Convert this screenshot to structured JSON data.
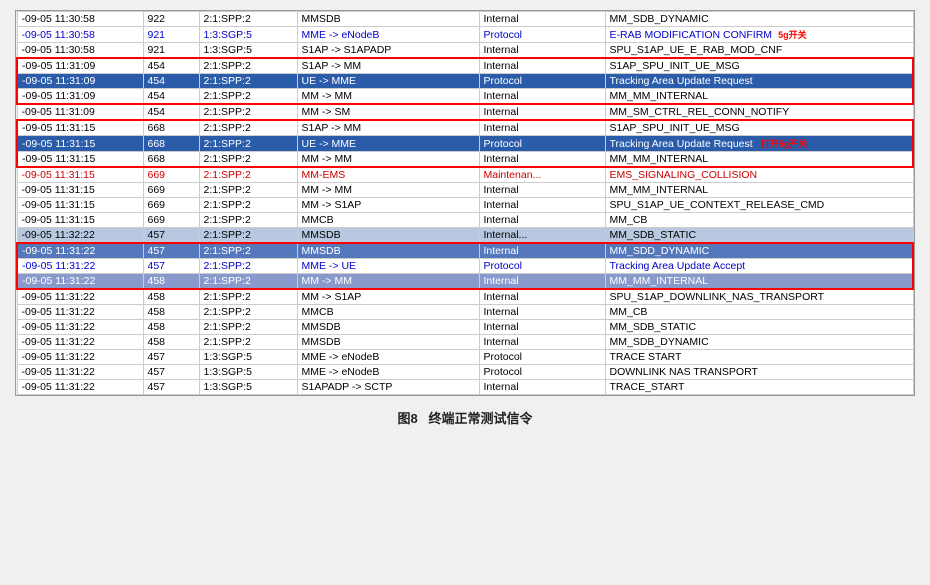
{
  "caption": {
    "figure_number": "图8",
    "title": "终端正常测试信令"
  },
  "rows": [
    {
      "ts": "-09-05 11:30:58",
      "id": "922",
      "node": "2:1:SPP:2",
      "source": "MMSDB",
      "type": "Internal",
      "msg": "MM_SDB_DYNAMIC",
      "style": "normal",
      "boxed": false
    },
    {
      "ts": "-09-05 11:30:58",
      "id": "921",
      "node": "1:3:SGP:5",
      "source": "MME -> eNodeB",
      "type": "Protocol",
      "msg": "E-RAB MODIFICATION CONFIRM",
      "style": "normal-blue-text",
      "boxed": false,
      "annotation": "5g开关"
    },
    {
      "ts": "-09-05 11:30:58",
      "id": "921",
      "node": "1:3:SGP:5",
      "source": "S1AP -> S1APADP",
      "type": "Internal",
      "msg": "SPU_S1AP_UE_E_RAB_MOD_CNF",
      "style": "normal",
      "boxed": false
    },
    {
      "ts": "-09-05 11:31:09",
      "id": "454",
      "node": "2:1:SPP:2",
      "source": "S1AP -> MM",
      "type": "Internal",
      "msg": "S1AP_SPU_INIT_UE_MSG",
      "style": "normal",
      "boxed": true
    },
    {
      "ts": "-09-05 11:31:09",
      "id": "454",
      "node": "2:1:SPP:2",
      "source": "UE -> MME",
      "type": "Protocol",
      "msg": "Tracking Area Update Request",
      "style": "highlight-blue",
      "boxed": true
    },
    {
      "ts": "-09-05 11:31:09",
      "id": "454",
      "node": "2:1:SPP:2",
      "source": "MM -> MM",
      "type": "Internal",
      "msg": "MM_MM_INTERNAL",
      "style": "normal",
      "boxed": true
    },
    {
      "ts": "-09-05 11:31:09",
      "id": "454",
      "node": "2:1:SPP:2",
      "source": "MM -> SM",
      "type": "Internal",
      "msg": "MM_SM_CTRL_REL_CONN_NOTIFY",
      "style": "normal",
      "boxed": false
    },
    {
      "ts": "-09-05 11:31:15",
      "id": "668",
      "node": "2:1:SPP:2",
      "source": "S1AP -> MM",
      "type": "Internal",
      "msg": "S1AP_SPU_INIT_UE_MSG",
      "style": "normal",
      "boxed": true
    },
    {
      "ts": "-09-05 11:31:15",
      "id": "668",
      "node": "2:1:SPP:2",
      "source": "UE -> MME",
      "type": "Protocol",
      "msg": "Tracking Area Update Request",
      "style": "highlight-blue",
      "boxed": true,
      "annotation": "打开5g开关"
    },
    {
      "ts": "-09-05 11:31:15",
      "id": "668",
      "node": "2:1:SPP:2",
      "source": "MM -> MM",
      "type": "Internal",
      "msg": "MM_MM_INTERNAL",
      "style": "normal",
      "boxed": true
    },
    {
      "ts": "-09-05 11:31:15",
      "id": "669",
      "node": "2:1:SPP:2",
      "source": "MM-EMS",
      "type": "Maintenan...",
      "msg": "EMS_SIGNALING_COLLISION",
      "style": "red-text",
      "boxed": false
    },
    {
      "ts": "-09-05 11:31:15",
      "id": "669",
      "node": "2:1:SPP:2",
      "source": "MM -> MM",
      "type": "Internal",
      "msg": "MM_MM_INTERNAL",
      "style": "normal",
      "boxed": false
    },
    {
      "ts": "-09-05 11:31:15",
      "id": "669",
      "node": "2:1:SPP:2",
      "source": "MM -> S1AP",
      "type": "Internal",
      "msg": "SPU_S1AP_UE_CONTEXT_RELEASE_CMD",
      "style": "normal",
      "boxed": false
    },
    {
      "ts": "-09-05 11:31:15",
      "id": "669",
      "node": "2:1:SPP:2",
      "source": "MMCB",
      "type": "Internal",
      "msg": "MM_CB",
      "style": "normal",
      "boxed": false
    },
    {
      "ts": "-09-05 11:32:22",
      "id": "457",
      "node": "2:1:SPP:2",
      "source": "MMSDB",
      "type": "Internal...",
      "msg": "MM_SDB_STATIC",
      "style": "gray-blue",
      "boxed": false
    },
    {
      "ts": "-09-05 11:31:22",
      "id": "457",
      "node": "2:1:SPP:2",
      "source": "MMSDB",
      "type": "Internal",
      "msg": "MM_SDD_DYNAMIC",
      "style": "highlight-blue-light",
      "boxed": true
    },
    {
      "ts": "-09-05 11:31:22",
      "id": "457",
      "node": "2:1:SPP:2",
      "source": "MME -> UE",
      "type": "Protocol",
      "msg": "Tracking Area Update Accept",
      "style": "normal-blue-text",
      "boxed": true
    },
    {
      "ts": "-09-05 11:31:22",
      "id": "458",
      "node": "2:1:SPP:2",
      "source": "MM -> MM",
      "type": "Internal",
      "msg": "MM_MM_INTERNAL",
      "style": "highlight-blue-light2",
      "boxed": true
    },
    {
      "ts": "-09-05 11:31:22",
      "id": "458",
      "node": "2:1:SPP:2",
      "source": "MM -> S1AP",
      "type": "Internal",
      "msg": "SPU_S1AP_DOWNLINK_NAS_TRANSPORT",
      "style": "normal",
      "boxed": false
    },
    {
      "ts": "-09-05 11:31:22",
      "id": "458",
      "node": "2:1:SPP:2",
      "source": "MMCB",
      "type": "Internal",
      "msg": "MM_CB",
      "style": "normal",
      "boxed": false
    },
    {
      "ts": "-09-05 11:31:22",
      "id": "458",
      "node": "2:1:SPP:2",
      "source": "MMSDB",
      "type": "Internal",
      "msg": "MM_SDB_STATIC",
      "style": "normal",
      "boxed": false
    },
    {
      "ts": "-09-05 11:31:22",
      "id": "458",
      "node": "2:1:SPP:2",
      "source": "MMSDB",
      "type": "Internal",
      "msg": "MM_SDB_DYNAMIC",
      "style": "normal",
      "boxed": false
    },
    {
      "ts": "-09-05 11:31:22",
      "id": "457",
      "node": "1:3:SGP:5",
      "source": "MME -> eNodeB",
      "type": "Protocol",
      "msg": "TRACE START",
      "style": "normal",
      "boxed": false
    },
    {
      "ts": "-09-05 11:31:22",
      "id": "457",
      "node": "1:3:SGP:5",
      "source": "MME -> eNodeB",
      "type": "Protocol",
      "msg": "DOWNLINK NAS TRANSPORT",
      "style": "normal",
      "boxed": false
    },
    {
      "ts": "-09-05 11:31:22",
      "id": "457",
      "node": "1:3:SGP:5",
      "source": "S1APADP -> SCTP",
      "type": "Internal",
      "msg": "TRACE_START",
      "style": "normal",
      "boxed": false
    }
  ]
}
